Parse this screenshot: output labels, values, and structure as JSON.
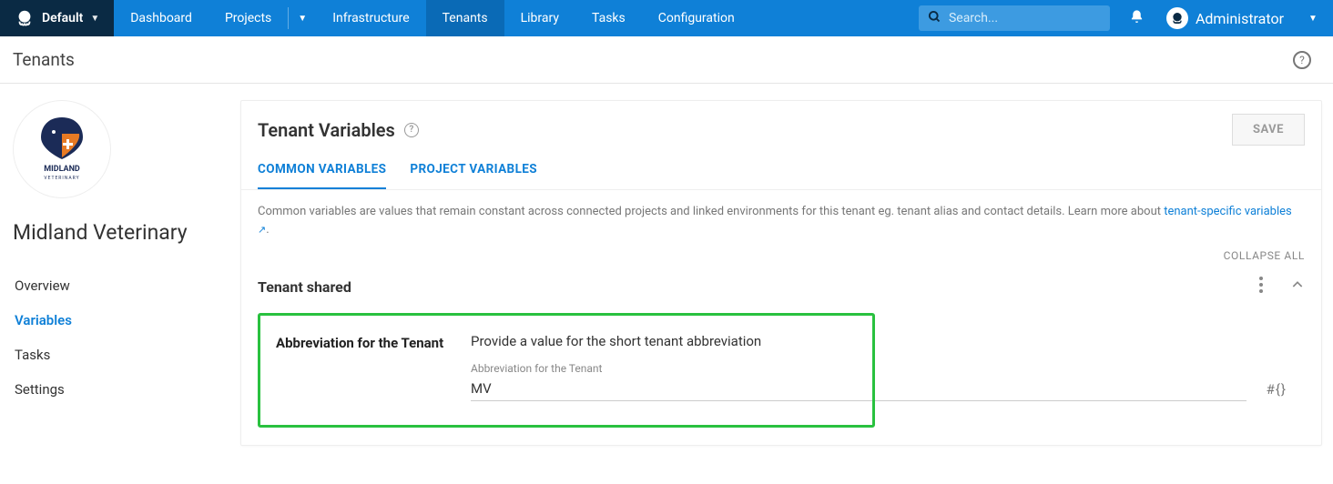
{
  "topbar": {
    "space_name": "Default",
    "nav": {
      "dashboard": "Dashboard",
      "projects": "Projects",
      "infrastructure": "Infrastructure",
      "tenants": "Tenants",
      "library": "Library",
      "tasks": "Tasks",
      "configuration": "Configuration"
    },
    "search_placeholder": "Search...",
    "user_name": "Administrator"
  },
  "subheader": {
    "title": "Tenants"
  },
  "sidebar": {
    "tenant_name": "Midland Veterinary",
    "logo_text_top": "MIDLAND",
    "logo_text_bottom": "VETERINARY",
    "items": {
      "overview": "Overview",
      "variables": "Variables",
      "tasks": "Tasks",
      "settings": "Settings"
    }
  },
  "card": {
    "title": "Tenant Variables",
    "save_label": "SAVE",
    "tabs": {
      "common": "COMMON VARIABLES",
      "project": "PROJECT VARIABLES"
    },
    "desc_prefix": "Common variables are values that remain constant across connected projects and linked environments for this tenant eg. tenant alias and contact details. Learn more about ",
    "desc_link": "tenant-specific variables",
    "desc_suffix": ".",
    "collapse_label": "COLLAPSE ALL",
    "section": {
      "title": "Tenant shared",
      "variable": {
        "name": "Abbreviation for the Tenant",
        "help": "Provide a value for the short tenant abbreviation",
        "field_label": "Abbreviation for the Tenant",
        "value": "MV",
        "hash_token": "#{}"
      }
    }
  }
}
